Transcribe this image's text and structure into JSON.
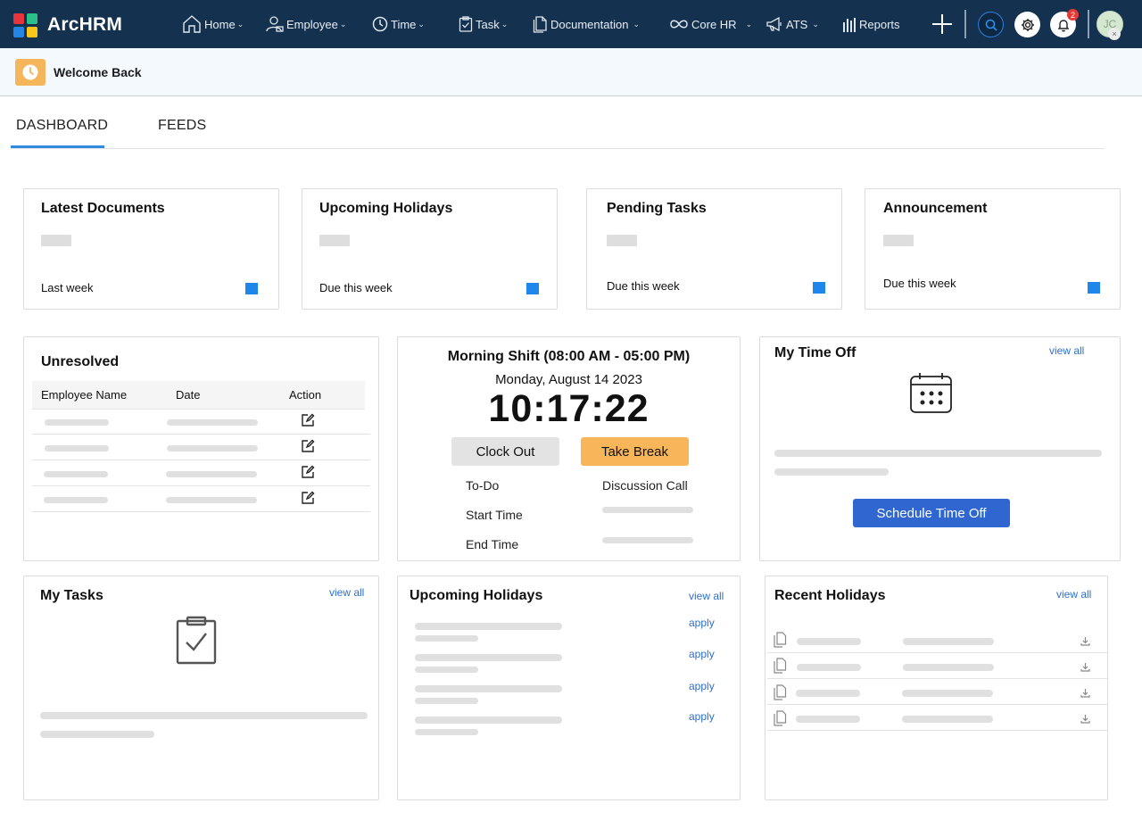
{
  "app": {
    "brand": "ArcHRM"
  },
  "nav": {
    "items": [
      {
        "label": "Home",
        "icon": "home-icon"
      },
      {
        "label": "Employee",
        "icon": "employee-icon"
      },
      {
        "label": "Time",
        "icon": "clock-icon"
      },
      {
        "label": "Task",
        "icon": "clipboard-icon"
      },
      {
        "label": "Documentation",
        "icon": "document-icon"
      },
      {
        "label": "Core HR",
        "icon": "infinity-icon"
      },
      {
        "label": "ATS",
        "icon": "megaphone-icon"
      },
      {
        "label": "Reports",
        "icon": "bar-chart-icon"
      }
    ],
    "notification_count": "2",
    "avatar_initials": "JC"
  },
  "welcome": {
    "text": "Welcome Back"
  },
  "tabs": [
    {
      "label": "DASHBOARD",
      "active": true
    },
    {
      "label": "FEEDS",
      "active": false
    }
  ],
  "summary_cards": [
    {
      "title": "Latest Documents",
      "subtitle": "Last week"
    },
    {
      "title": "Upcoming Holidays",
      "subtitle": "Due this week"
    },
    {
      "title": "Pending Tasks",
      "subtitle": "Due this week"
    },
    {
      "title": "Announcement",
      "subtitle": "Due this week"
    }
  ],
  "unresolved": {
    "title": "Unresolved",
    "columns": [
      "Employee Name",
      "Date",
      "Action"
    ]
  },
  "shift": {
    "title": "Morning Shift (08:00 AM - 05:00 PM)",
    "date": "Monday, August 14 2023",
    "time": "10:17:22",
    "clock_out_label": "Clock Out",
    "take_break_label": "Take Break",
    "todo_label": "To-Do",
    "todo_value": "Discussion Call",
    "start_label": "Start Time",
    "end_label": "End Time"
  },
  "time_off": {
    "title": "My Time Off",
    "view_all": "view all",
    "schedule_label": "Schedule Time Off"
  },
  "my_tasks": {
    "title": "My Tasks",
    "view_all": "view all"
  },
  "upcoming_holidays": {
    "title": "Upcoming Holidays",
    "view_all": "view all",
    "apply_label": "apply"
  },
  "recent_holidays": {
    "title": "Recent Holidays",
    "view_all": "view all"
  },
  "colors": {
    "nav_bg": "#14314f",
    "accent_blue": "#1f87ea",
    "primary_button": "#2f66d0",
    "break_button": "#f8b65a"
  }
}
